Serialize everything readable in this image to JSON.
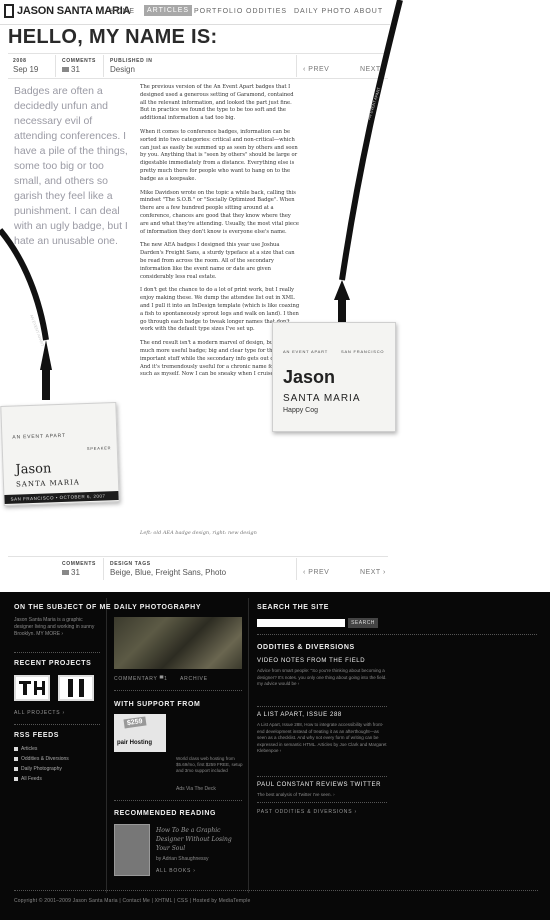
{
  "header": {
    "logo": "JASON SANTA MARIA",
    "nav": [
      "HOME",
      "ARTICLES",
      "PORTFOLIO",
      "ODDITIES",
      "DAILY PHOTO",
      "ABOUT"
    ],
    "active": "ARTICLES"
  },
  "article": {
    "title": "HELLO, MY NAME IS:",
    "meta": {
      "date_label": "2008",
      "date": "Sep 19",
      "comments_label": "COMMENTS",
      "comments": "31",
      "published_label": "PUBLISHED IN",
      "category": "Design",
      "prev": "‹ PREV",
      "next": "NEXT ›"
    },
    "intro": "Badges are often a decidedly unfun and necessary evil of attending conferences. I have a pile of the things, some too big or too small, and others so garish they feel like a punishment. I can deal with an ugly badge, but I hate an unusable one.",
    "paragraphs": [
      "The previous version of the An Event Apart badges that I designed used a generous setting of Garamond, contained all the relevant information, and looked the part just fine. But in practice we found the type to be too soft and the additional information a tad too big.",
      "When it comes to conference badges, information can be sorted into two categories: critical and non-critical—which can just as easily be summed up as seen by others and seen by you. Anything that is \"seen by others\" should be large or digestable immediately from a distance. Everything else is pretty much there for people who want to hang on to the badge as a keepsake.",
      "Mike Davidson wrote on the topic a while back, calling this mindset \"The S.O.B.\" or \"Socially Optimized Badge\". When there are a few hundred people sitting around at a conference, chances are good that they know where they are and what they're attending. Usually, the most vital piece of information they don't know is everyone else's name.",
      "The new AEA badges I designed this year use Joshua Darden's Freight Sans, a sturdy typeface at a size that can be read from across the room. All of the secondary information like the event name or date are given considerably less real estate.",
      "I don't get the chance to do a lot of print work, but I really enjoy making these. We dump the attendee list out in XML and I pull it into an InDesign template (which is like coaxing a fish to spontaneously sprout legs and walk on land). I then go through each badge to tweak longer names that don't work with the default type sizes I've set up.",
      "The end result isn't a modern marvel of design, but it is a much more useful badge; big and clear type for the important stuff while the secondary info gets out of the way. And it's tremendously useful for a chronic name forgetter such as myself. Now I can be sneaky when I cruise badges."
    ],
    "caption": "Left: old AEA badge design, right: new design",
    "footer_meta": {
      "comments_label": "COMMENTS",
      "comments": "31",
      "tags_label": "DESIGN TAGS",
      "tags": "Beige, Blue, Freight Sans, Photo",
      "prev": "‹ PREV",
      "next": "NEXT ›"
    }
  },
  "badges": {
    "old": {
      "event": "AN EVENT APART",
      "role": "SPEAKER",
      "first": "Jason",
      "last": "SANTA MARIA",
      "strip": "SAN FRANCISCO • OCTOBER 6, 2007",
      "lanyard_text": "AN EVENT APART"
    },
    "new": {
      "event": "AN EVENT APART",
      "event_detail": "SAN FRANCISCO",
      "first": "Jason",
      "last": "SANTA MARIA",
      "org": "Happy Cog",
      "lanyard_text": "AN EVENT APART"
    }
  },
  "footer": {
    "subject": {
      "heading": "ON THE SUBJECT OF ME",
      "text": "Jason Santa Maria is a graphic designer living and working in sunny Brooklyn. MY MORE ›",
      "projects_heading": "RECENT PROJECTS",
      "all_projects": "ALL PROJECTS ›",
      "rss_heading": "RSS FEEDS",
      "feeds": [
        "Articles",
        "Oddities & Diversions",
        "Daily Photography",
        "All Feeds"
      ]
    },
    "photo": {
      "heading": "DAILY PHOTOGRAPHY",
      "commentary": "COMMENTARY",
      "comments": "1",
      "archive": "ARCHIVE",
      "support_heading": "WITH SUPPORT FROM",
      "sponsor_badge": "$259",
      "sponsor_name": "pair Hosting",
      "sponsor_text": "World class web hosting from $5.69/mo, first $259 FREE, setup and 3mo support included",
      "ad_link": "Ads Via The Deck",
      "reading_heading": "RECOMMENDED READING",
      "book_title": "How To Be a Graphic Designer Without Losing Your Soul",
      "book_author": "by Adrian Shaughnessy",
      "all_books": "ALL BOOKS ›"
    },
    "search": {
      "heading": "SEARCH THE SITE",
      "placeholder": "",
      "button": "SEARCH",
      "oddities_heading": "ODDITIES & DIVERSIONS",
      "item1_title": "VIDEO NOTES FROM THE FIELD",
      "item1_text": "Advice from smart people: \"So you're thinking about becoming a designer? It's notes. you only one thing about going into the field. my advice would be ›",
      "item2_title": "A LIST APART, ISSUE 288",
      "item2_text": "A List Apart, Issue 288, How to integrate accessibility with front-end development instead of treating it as an afterthought—as seen as a checklist. And why not every form of writing can be expressed in semantic HTML. Articles by Joe Clark and Margaret Klebenpoe ›",
      "item3_title": "PAUL CONSTANT REVIEWS TWITTER",
      "item3_text": "The best analysis of Twitter I've seen. ›",
      "past": "PAST ODDITIES & DIVERSIONS ›"
    },
    "copyright": "Copyright © 2001–2009 Jason Santa Maria  |  Contact Me  |  XHTML  |  CSS  |  Hosted by MediaTemple"
  },
  "colors": {
    "footer_bg": "#080808",
    "intro_text": "#9a9aa4",
    "nav_active_bg": "#a8a8a8"
  }
}
